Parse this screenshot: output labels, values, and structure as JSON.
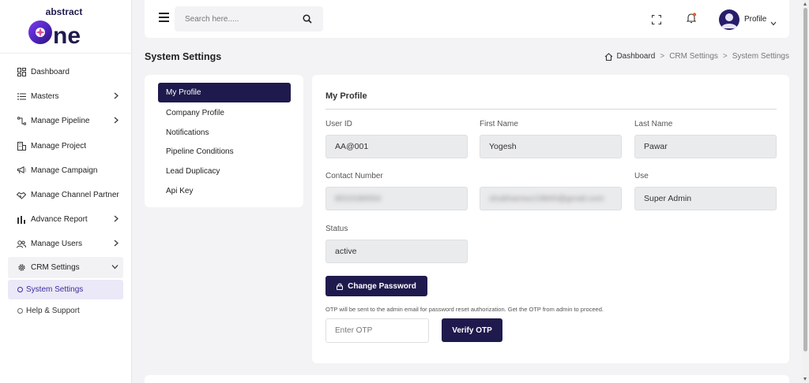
{
  "brand": {
    "logo_text_top": "abstract",
    "logo_text_main": "one"
  },
  "sidebar": {
    "items": [
      {
        "label": "Dashboard",
        "icon": "dashboard-icon",
        "has_submenu": false
      },
      {
        "label": "Masters",
        "icon": "list-icon",
        "has_submenu": true
      },
      {
        "label": "Manage Pipeline",
        "icon": "pipeline-icon",
        "has_submenu": true
      },
      {
        "label": "Manage Project",
        "icon": "building-icon",
        "has_submenu": false
      },
      {
        "label": "Manage Campaign",
        "icon": "megaphone-icon",
        "has_submenu": false
      },
      {
        "label": "Manage Channel Partner",
        "icon": "handshake-icon",
        "has_submenu": false
      },
      {
        "label": "Advance Report",
        "icon": "bar-chart-icon",
        "has_submenu": true
      },
      {
        "label": "Manage Users",
        "icon": "users-icon",
        "has_submenu": true
      },
      {
        "label": "CRM Settings",
        "icon": "gear-icon",
        "has_submenu": true,
        "expanded": true
      }
    ],
    "crm_sub": [
      {
        "label": "System Settings",
        "active": true
      }
    ],
    "help": {
      "label": "Help & Support"
    }
  },
  "topbar": {
    "search_placeholder": "Search here.....",
    "profile_label": "Profile"
  },
  "page": {
    "title": "System Settings",
    "breadcrumb": [
      "Dashboard",
      "CRM Settings",
      "System Settings"
    ]
  },
  "settings_menu": {
    "items": [
      "My Profile",
      "Company Profile",
      "Notifications",
      "Pipeline Conditions",
      "Lead Duplicacy",
      "Api Key"
    ],
    "active_index": 0
  },
  "profile": {
    "title": "My Profile",
    "fields": {
      "user_id": {
        "label": "User ID",
        "value": "AA@001"
      },
      "first_name": {
        "label": "First Name",
        "value": "Yogesh"
      },
      "last_name": {
        "label": "Last Name",
        "value": "Pawar"
      },
      "contact": {
        "label": "Contact Number",
        "value": "8010180054"
      },
      "email": {
        "label": "",
        "value": "shubhamsur19840@gmail.com"
      },
      "user_type": {
        "label": "Use",
        "value": "Super Admin"
      },
      "status": {
        "label": "Status",
        "value": "active"
      }
    },
    "change_password_label": "Change Password",
    "otp_note": "OTP will be sent to the admin email for password reset authorization. Get the OTP from admin to proceed.",
    "otp_placeholder": "Enter OTP",
    "verify_otp_label": "Verify OTP"
  },
  "colors": {
    "primary": "#1f1a4d",
    "accent": "#3b2e9a",
    "notification_dot": "#e85c2a",
    "logo_purple": "#5a2fd0"
  }
}
